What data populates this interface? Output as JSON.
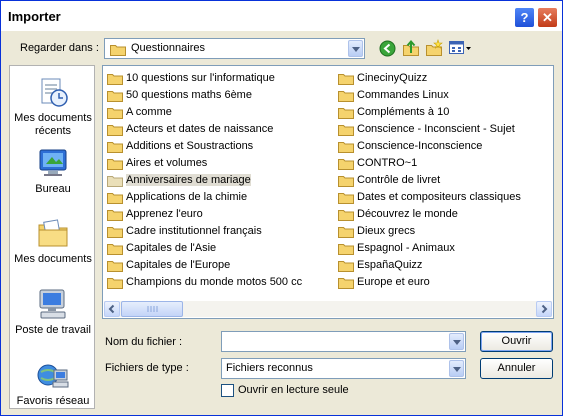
{
  "window": {
    "title": "Importer"
  },
  "titlebar": {
    "help_glyph": "?",
    "close_glyph": "✕"
  },
  "lookin": {
    "label": "Regarder dans :",
    "value": "Questionnaires"
  },
  "toolbar_icons": [
    "back-icon",
    "up-folder-icon",
    "new-folder-icon",
    "views-menu-icon"
  ],
  "places": [
    {
      "label": "Mes documents récents",
      "icon": "recent-documents-icon"
    },
    {
      "label": "Bureau",
      "icon": "desktop-icon"
    },
    {
      "label": "Mes documents",
      "icon": "my-documents-icon"
    },
    {
      "label": "Poste de travail",
      "icon": "my-computer-icon"
    },
    {
      "label": "Favoris réseau",
      "icon": "network-places-icon"
    }
  ],
  "files": {
    "selected": "Anniversaires de mariage",
    "col1": [
      "10 questions sur l'informatique",
      "50 questions maths 6ème",
      "A comme",
      "Acteurs et dates de naissance",
      "Additions et Soustractions",
      "Aires et volumes",
      "Anniversaires de mariage",
      "Applications de la chimie",
      "Apprenez l'euro",
      "Cadre institutionnel français",
      "Capitales de l'Asie",
      "Capitales de l'Europe",
      "Champions du monde motos 500 cc"
    ],
    "col2": [
      "CinecinyQuizz",
      "Commandes Linux",
      "Compléments à 10",
      "Conscience - Inconscient - Sujet",
      "Conscience-Inconscience",
      "CONTRO~1",
      "Contrôle de livret",
      "Dates et compositeurs classiques",
      "Découvrez le monde",
      "Dieux grecs",
      "Espagnol - Animaux",
      "EspañaQuizz",
      "Europe et euro"
    ]
  },
  "filename": {
    "label": "Nom du fichier :",
    "value": ""
  },
  "filetype": {
    "label": "Fichiers de type :",
    "value": "Fichiers reconnus"
  },
  "readonly": {
    "label": "Ouvrir en lecture seule",
    "checked": false
  },
  "buttons": {
    "open": "Ouvrir",
    "cancel": "Annuler"
  },
  "colors": {
    "titlebar_border": "#0831d9",
    "face": "#ece9d8",
    "folder": "#f5d36d",
    "close_red": "#c23b17"
  }
}
